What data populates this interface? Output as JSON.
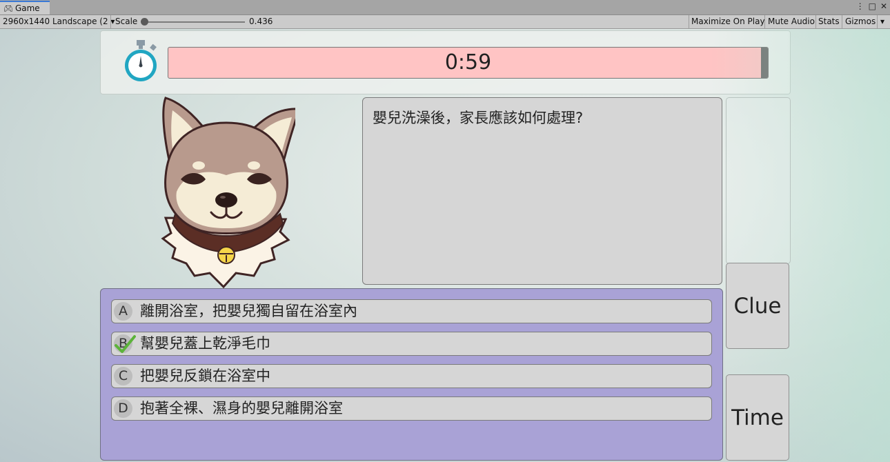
{
  "editor": {
    "tab_label": "Game",
    "resolution": "2960x1440 Landscape (2",
    "scale_label": "Scale",
    "scale_value": "0.436",
    "maximize_on_play": "Maximize On Play",
    "mute_audio": "Mute Audio",
    "stats": "Stats",
    "gizmos": "Gizmos"
  },
  "timer": {
    "text": "0:59",
    "bar_color": "#ffc4c4"
  },
  "question": {
    "text": "嬰兒洗澡後，家長應該如何處理?"
  },
  "buttons": {
    "clue": "Clue",
    "time": "Time"
  },
  "answers": [
    {
      "letter": "A",
      "text": "離開浴室，把嬰兒獨自留在浴室內",
      "checked": false
    },
    {
      "letter": "B",
      "text": "幫嬰兒蓋上乾淨毛巾",
      "checked": true
    },
    {
      "letter": "C",
      "text": "把嬰兒反鎖在浴室中",
      "checked": false
    },
    {
      "letter": "D",
      "text": "抱著全裸、濕身的嬰兒離開浴室",
      "checked": false
    }
  ],
  "colors": {
    "answers_panel": "#a9a2d6",
    "check_mark": "#5cb33a",
    "stopwatch": "#21a6c2"
  }
}
